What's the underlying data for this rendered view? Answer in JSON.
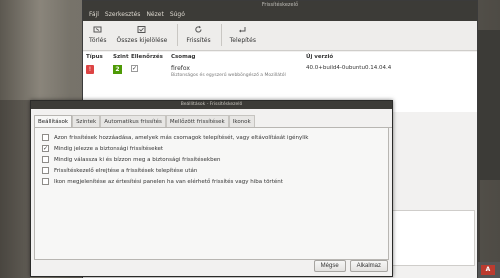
{
  "main_window": {
    "title": "Frissítéskezelő",
    "menu": [
      "Fájl",
      "Szerkesztés",
      "Nézet",
      "Súgó"
    ],
    "toolbar": {
      "clear_label": "Törlés",
      "select_all_label": "Összes kijelölése",
      "refresh_label": "Frissítés",
      "install_label": "Telepítés"
    },
    "table": {
      "headers": [
        "Típus",
        "Szint",
        "Ellenőrzés",
        "Csomag",
        "Új verzió"
      ],
      "rows": [
        {
          "type_icon": "!",
          "level": "2",
          "checked": "✓",
          "package": "firefox",
          "description": "Biztonságos és egyszerű webböngésző a Mozillától",
          "new_version": "40.0+build4-0ubuntu0.14.04.4"
        }
      ]
    }
  },
  "dialog": {
    "title": "Beállítások - Frissítéskezelő",
    "tabs": [
      "Beállítások",
      "Szintek",
      "Automatikus frissítés",
      "Mellőzött frissítések",
      "Ikonok"
    ],
    "options": [
      {
        "label": "Azon frissítések hozzáadása, amelyek más csomagok telepítését, vagy eltávolítását igénylik",
        "checked": ""
      },
      {
        "label": "Mindig jelezze a biztonsági frissítéseket",
        "checked": "✓"
      },
      {
        "label": "Mindig válassza ki és bízzon meg a biztonsági frissítésekben",
        "checked": ""
      },
      {
        "label": "Frissítéskezelő elrejtése a frissítések telepítése után",
        "checked": ""
      },
      {
        "label": "Ikon megjelenítése az értesítési panelen ha van elérhető frissítés vagy hiba történt",
        "checked": ""
      }
    ],
    "cancel_label": "Mégse",
    "apply_label": "Alkalmaz"
  },
  "colors": {
    "panel_dark": "#3c3b37",
    "window_bg": "#f2f1f0",
    "badge_red": "#dd4444",
    "badge_green": "#4e9a06"
  }
}
